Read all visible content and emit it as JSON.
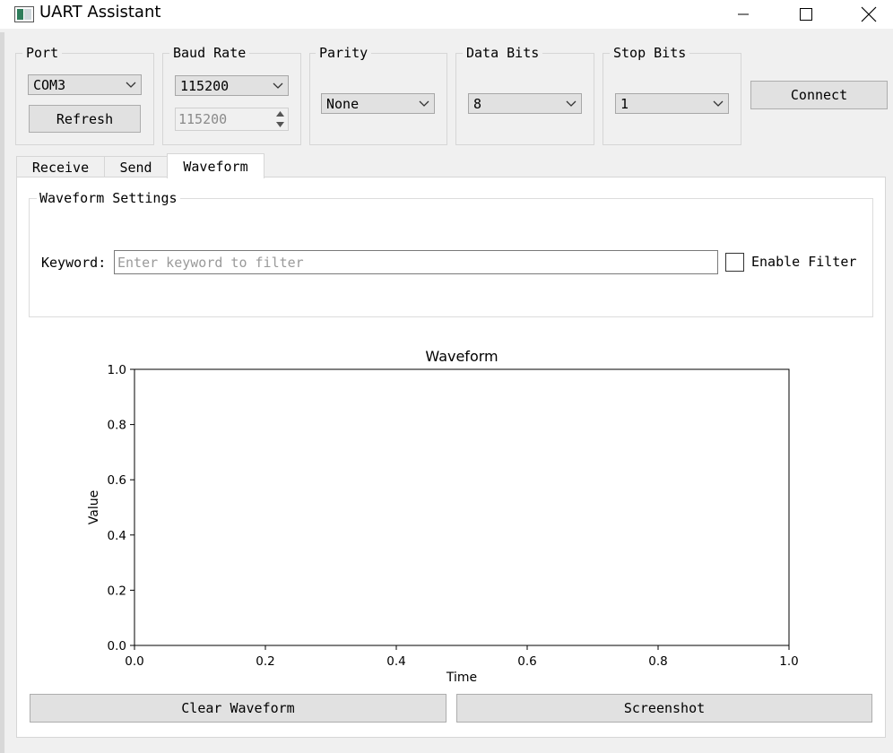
{
  "window": {
    "title": "UART Assistant"
  },
  "settings": {
    "port": {
      "label": "Port",
      "value": "COM3",
      "refresh_label": "Refresh"
    },
    "baud_rate": {
      "label": "Baud Rate",
      "value": "115200",
      "custom_value": "115200"
    },
    "parity": {
      "label": "Parity",
      "value": "None"
    },
    "data_bits": {
      "label": "Data Bits",
      "value": "8"
    },
    "stop_bits": {
      "label": "Stop Bits",
      "value": "1"
    },
    "connect_label": "Connect"
  },
  "tabs": [
    {
      "label": "Receive",
      "active": false
    },
    {
      "label": "Send",
      "active": false
    },
    {
      "label": "Waveform",
      "active": true
    }
  ],
  "waveform": {
    "settings_title": "Waveform Settings",
    "keyword_label": "Keyword:",
    "keyword_value": "",
    "keyword_placeholder": "Enter keyword to filter",
    "enable_filter_label": "Enable Filter",
    "enable_filter_checked": false,
    "clear_label": "Clear Waveform",
    "screenshot_label": "Screenshot"
  },
  "chart_data": {
    "type": "line",
    "title": "Waveform",
    "xlabel": "Time",
    "ylabel": "Value",
    "xlim": [
      0.0,
      1.0
    ],
    "ylim": [
      0.0,
      1.0
    ],
    "x_ticks": [
      "0.0",
      "0.2",
      "0.4",
      "0.6",
      "0.8",
      "1.0"
    ],
    "y_ticks": [
      "0.0",
      "0.2",
      "0.4",
      "0.6",
      "0.8",
      "1.0"
    ],
    "series": [],
    "grid": false
  }
}
